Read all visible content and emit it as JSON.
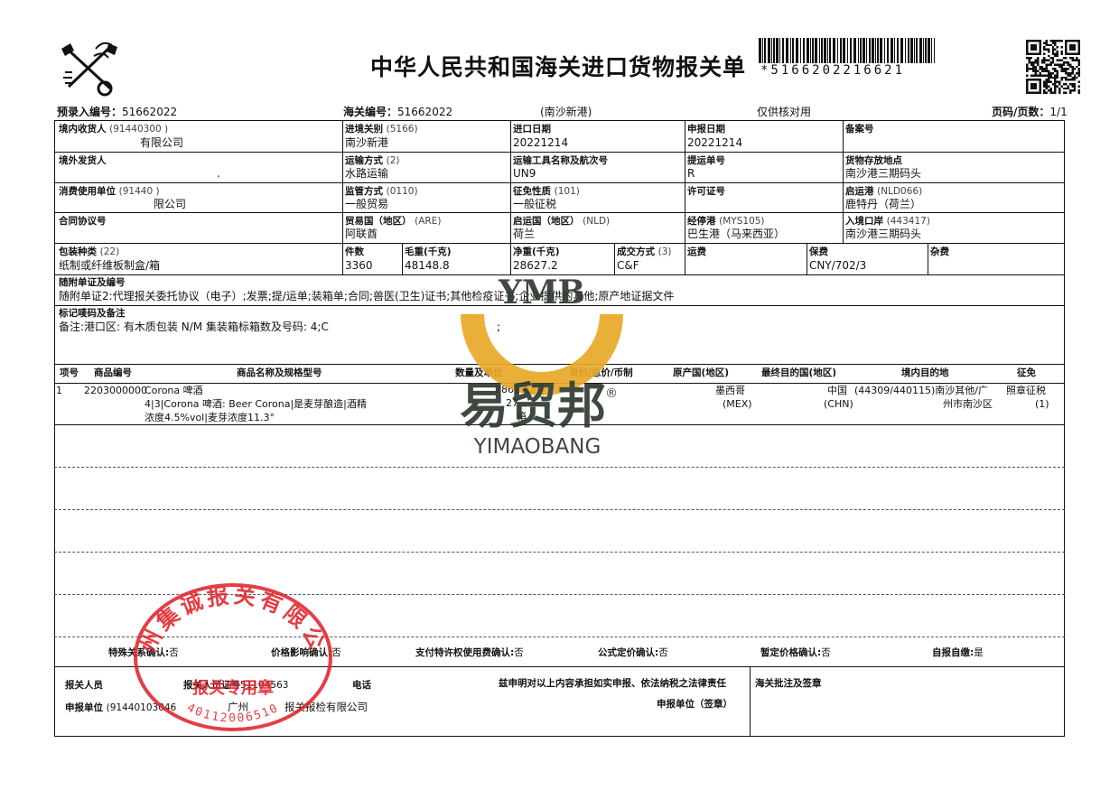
{
  "header": {
    "title": "中华人民共和国海关进口货物报关单",
    "barcode_number": "*5166202216621",
    "preentry_label": "预录入编号：",
    "preentry_value": "51662022",
    "customs_no_label": "海关编号：",
    "customs_no_value": "51662022",
    "port_note": "(南沙新港)",
    "verify_note": "仅供核对用",
    "page_label": "页码/页数：",
    "page_value": "1/1"
  },
  "rows": {
    "r1": {
      "consignee_label": "境内收货人",
      "consignee_code": "(91440300          )",
      "consignee_value": "有限公司",
      "entry_customs_label": "进境关别",
      "entry_customs_code": "(5166)",
      "entry_customs_value": "南沙新港",
      "import_date_label": "进口日期",
      "import_date_value": "20221214",
      "declare_date_label": "申报日期",
      "declare_date_value": "20221214",
      "record_no_label": "备案号",
      "record_no_value": ""
    },
    "r2": {
      "consignor_label": "境外发货人",
      "consignor_value": ".",
      "transport_label": "运输方式",
      "transport_code": "(2)",
      "transport_value": "水路运输",
      "vessel_label": "运输工具名称及航次号",
      "vessel_value": "UN9",
      "bl_label": "提运单号",
      "bl_value": "R",
      "storage_label": "货物存放地点",
      "storage_value": "南沙港三期码头"
    },
    "r3": {
      "user_label": "消费使用单位",
      "user_code": "(91440              )",
      "user_value": "限公司",
      "supervision_label": "监管方式",
      "supervision_code": "(0110)",
      "supervision_value": "一般贸易",
      "levy_label": "征免性质",
      "levy_code": "(101)",
      "levy_value": "一般征税",
      "license_label": "许可证号",
      "license_value": "",
      "departure_label": "启运港",
      "departure_code": "(NLD066)",
      "departure_value": "鹿特丹（荷兰）"
    },
    "r4": {
      "contract_label": "合同协议号",
      "contract_value": "",
      "trade_country_label": "贸易国（地区）",
      "trade_country_code": "(ARE)",
      "trade_country_value": "阿联酋",
      "origin_country_label": "启运国（地区）",
      "origin_country_code": "(NLD)",
      "origin_country_value": "荷兰",
      "stop_port_label": "经停港",
      "stop_port_code": "(MYS105)",
      "stop_port_value": "巴生港（马来西亚）",
      "entry_port_label": "入境口岸",
      "entry_port_code": "(443417)",
      "entry_port_value": "南沙港三期码头"
    },
    "r5": {
      "package_label": "包装种类",
      "package_code": "(22)",
      "package_value": "纸制或纤维板制盒/箱",
      "pieces_label": "件数",
      "pieces_value": "3360",
      "gross_label": "毛重(千克)",
      "gross_value": "48148.8",
      "net_label": "净重(千克)",
      "net_value": "28627.2",
      "deal_label": "成交方式",
      "deal_code": "(3)",
      "deal_value": "C&F",
      "freight_label": "运费",
      "freight_value": "",
      "insurance_label": "保费",
      "insurance_value": "CNY/702/3",
      "misc_label": "杂费",
      "misc_value": ""
    },
    "docs": {
      "label": "随附单证及编号",
      "value": "随附单证2:代理报关委托协议（电子）;发票;提/运单;装箱单;合同;兽医(卫生)证书;其他检疫证书;企业提供的其他;原产地证据文件"
    },
    "marks": {
      "label": "标记唛码及备注",
      "value": "备注:港口区: 有木质包装 N/M  集装箱标箱数及号码: 4;C",
      "value2": ";"
    }
  },
  "goods_table": {
    "headers": [
      "项号",
      "商品编号",
      "商品名称及规格型号",
      "数量及单位",
      "单价/总价/币制",
      "原产国(地区)",
      "最终目的国(地区)",
      "境内目的地",
      "征免"
    ],
    "rows": [
      {
        "item": "1",
        "hs_code": "2203000000",
        "name_line1": "Corona 啤酒",
        "name_line2": "4|3|Corona 啤酒: Beer Corona|是麦芽酿造|酒精",
        "name_line3": "浓度4.5%vol|麦芽浓度11.3°",
        "qty_line1": "28627.2升",
        "qty_line2": "27",
        "qty_line3": "箱",
        "origin": "墨西哥",
        "origin_code": "(MEX)",
        "dest_country": "中国",
        "dest_country_code": "(CHN)",
        "domestic_dest_line1": "(44309/440115)南沙其他/广",
        "domestic_dest_line2": "州市南沙区",
        "levy_line1": "照章征税",
        "levy_line2": "(1)"
      }
    ]
  },
  "confirmations": {
    "special_label": "特殊关系确认:",
    "special_value": "否",
    "price_label": "价格影响确认:",
    "price_value": "否",
    "royalty_label": "支付特许权使用费确认:",
    "royalty_value": "否",
    "formula_label": "公式定价确认:",
    "formula_value": "否",
    "provisional_label": "暂定价格确认:",
    "provisional_value": "否",
    "self_report_label": "自报自缴:",
    "self_report_value": "是"
  },
  "footer": {
    "declarer_label": "报关人员",
    "declarer_cert_label": "报关人员证号",
    "declarer_cert_value": "51104563",
    "phone_label": "电话",
    "statement": "兹申明对以上内容承担如实申报、依法纳税之法律责任",
    "unit_label": "申报单位",
    "unit_code": "(9144010",
    "unit_code_tail": "3046",
    "unit_city": "广州",
    "unit_name": "报关报检有限公司",
    "unit_seal_label": "申报单位（签章）",
    "customs_note_label": "海关批注及签章"
  },
  "watermark": {
    "brand_en": "YMB",
    "brand_cn": "易贸邦",
    "brand_pinyin": "YIMAOBANG",
    "registered": "®",
    "color_gold": "#E8A928",
    "color_dark": "#2F3A30"
  },
  "stamp": {
    "ring_text": "广州集诚报关有限公司",
    "center_text": "报关专用章",
    "bottom_digits": "40112006510",
    "color": "#E0242B"
  }
}
